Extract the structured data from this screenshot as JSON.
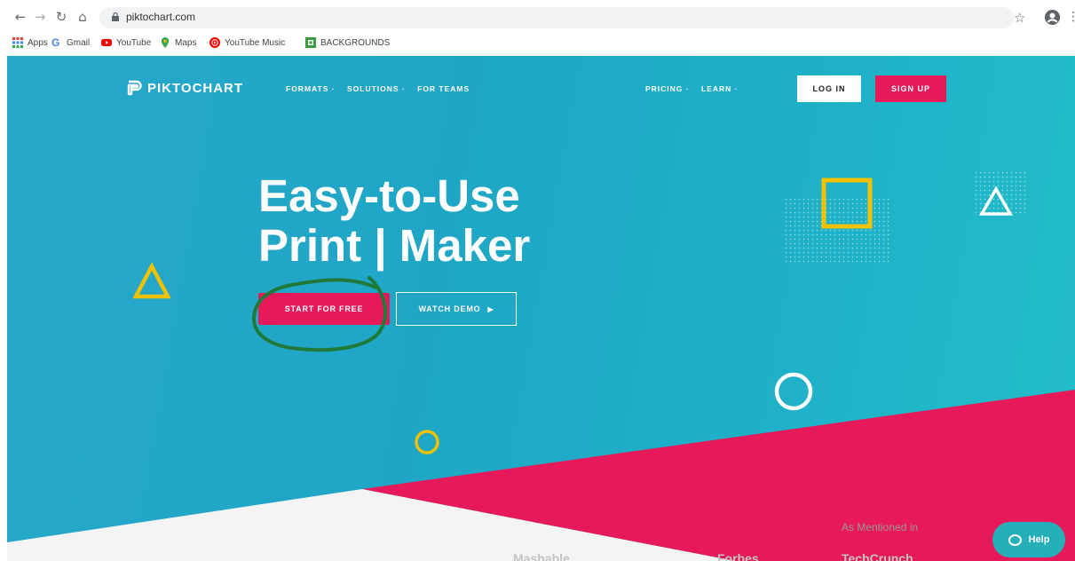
{
  "browser": {
    "url": "piktochart.com",
    "bookmarks": [
      {
        "label": "Apps",
        "icon": "apps-grid-icon",
        "color": "#e94235"
      },
      {
        "label": "Gmail",
        "icon": "google-icon",
        "color": "#4285f4"
      },
      {
        "label": "YouTube",
        "icon": "youtube-icon",
        "color": "#ff0000"
      },
      {
        "label": "Maps",
        "icon": "maps-pin-icon",
        "color": "#34a853"
      },
      {
        "label": "YouTube Music",
        "icon": "youtube-music-icon",
        "color": "#ff0000"
      },
      {
        "label": "BACKGROUNDS",
        "icon": "image-folder-icon",
        "color": "#3c9a3f"
      }
    ]
  },
  "site": {
    "brand": "PIKTOCHART",
    "nav_left": [
      "FORMATS ·",
      "SOLUTIONS ·",
      "FOR TEAMS"
    ],
    "nav_right": [
      "PRICING ·",
      "LEARN ·"
    ],
    "login": "LOG IN",
    "signup": "SIGN UP"
  },
  "hero": {
    "headline_line1": "Easy-to-Use",
    "headline_line2": "Print | Maker",
    "start_button": "START FOR FREE",
    "demo_button": "WATCH DEMO"
  },
  "mentions": {
    "heading": "As Mentioned in",
    "logos": [
      "Mashable",
      "Forbes",
      "TechCrunch"
    ]
  },
  "help": {
    "label": "Help"
  },
  "colors": {
    "hero_bg": "#1fa6c6",
    "accent_pink": "#e6195a",
    "deco_yellow": "#f2c200",
    "annotation_green": "#1f7a3a"
  }
}
